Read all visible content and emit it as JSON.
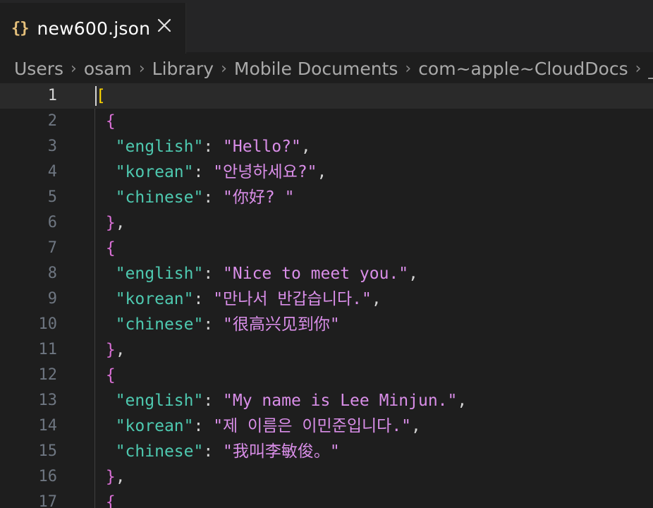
{
  "tab": {
    "icon_glyph": "{}",
    "filename": "new600.json",
    "close_glyph": "×"
  },
  "breadcrumb": [
    "Users",
    "osam",
    "Library",
    "Mobile Documents",
    "com~apple~CloudDocs",
    "_"
  ],
  "colors": {
    "key": "#4ec9b0",
    "string": "#d98ee8",
    "bracket": "#ffd700",
    "brace": "#da70d6",
    "json_icon": "#e5c07b"
  },
  "lines": [
    {
      "n": "1",
      "tokens": [
        {
          "t": "[",
          "c": "bracket"
        }
      ]
    },
    {
      "n": "2",
      "tokens": [
        {
          "t": " {",
          "c": "brace"
        }
      ]
    },
    {
      "n": "3",
      "tokens": [
        {
          "t": "  ",
          "c": "punc"
        },
        {
          "t": "\"english\"",
          "c": "key"
        },
        {
          "t": ": ",
          "c": "punc"
        },
        {
          "t": "\"Hello?\"",
          "c": "str"
        },
        {
          "t": ",",
          "c": "punc"
        }
      ]
    },
    {
      "n": "4",
      "tokens": [
        {
          "t": "  ",
          "c": "punc"
        },
        {
          "t": "\"korean\"",
          "c": "key"
        },
        {
          "t": ": ",
          "c": "punc"
        },
        {
          "t": "\"안녕하세요?\"",
          "c": "str"
        },
        {
          "t": ",",
          "c": "punc"
        }
      ]
    },
    {
      "n": "5",
      "tokens": [
        {
          "t": "  ",
          "c": "punc"
        },
        {
          "t": "\"chinese\"",
          "c": "key"
        },
        {
          "t": ": ",
          "c": "punc"
        },
        {
          "t": "\"你好? \"",
          "c": "str"
        }
      ]
    },
    {
      "n": "6",
      "tokens": [
        {
          "t": " }",
          "c": "brace"
        },
        {
          "t": ",",
          "c": "punc"
        }
      ]
    },
    {
      "n": "7",
      "tokens": [
        {
          "t": " {",
          "c": "brace"
        }
      ]
    },
    {
      "n": "8",
      "tokens": [
        {
          "t": "  ",
          "c": "punc"
        },
        {
          "t": "\"english\"",
          "c": "key"
        },
        {
          "t": ": ",
          "c": "punc"
        },
        {
          "t": "\"Nice to meet you.\"",
          "c": "str"
        },
        {
          "t": ",",
          "c": "punc"
        }
      ]
    },
    {
      "n": "9",
      "tokens": [
        {
          "t": "  ",
          "c": "punc"
        },
        {
          "t": "\"korean\"",
          "c": "key"
        },
        {
          "t": ": ",
          "c": "punc"
        },
        {
          "t": "\"만나서 반갑습니다.\"",
          "c": "str"
        },
        {
          "t": ",",
          "c": "punc"
        }
      ]
    },
    {
      "n": "10",
      "tokens": [
        {
          "t": "  ",
          "c": "punc"
        },
        {
          "t": "\"chinese\"",
          "c": "key"
        },
        {
          "t": ": ",
          "c": "punc"
        },
        {
          "t": "\"很高兴见到你\"",
          "c": "str"
        }
      ]
    },
    {
      "n": "11",
      "tokens": [
        {
          "t": " }",
          "c": "brace"
        },
        {
          "t": ",",
          "c": "punc"
        }
      ]
    },
    {
      "n": "12",
      "tokens": [
        {
          "t": " {",
          "c": "brace"
        }
      ]
    },
    {
      "n": "13",
      "tokens": [
        {
          "t": "  ",
          "c": "punc"
        },
        {
          "t": "\"english\"",
          "c": "key"
        },
        {
          "t": ": ",
          "c": "punc"
        },
        {
          "t": "\"My name is Lee Minjun.\"",
          "c": "str"
        },
        {
          "t": ",",
          "c": "punc"
        }
      ]
    },
    {
      "n": "14",
      "tokens": [
        {
          "t": "  ",
          "c": "punc"
        },
        {
          "t": "\"korean\"",
          "c": "key"
        },
        {
          "t": ": ",
          "c": "punc"
        },
        {
          "t": "\"제 이름은 이민준입니다.\"",
          "c": "str"
        },
        {
          "t": ",",
          "c": "punc"
        }
      ]
    },
    {
      "n": "15",
      "tokens": [
        {
          "t": "  ",
          "c": "punc"
        },
        {
          "t": "\"chinese\"",
          "c": "key"
        },
        {
          "t": ": ",
          "c": "punc"
        },
        {
          "t": "\"我叫李敏俊。\"",
          "c": "str"
        }
      ]
    },
    {
      "n": "16",
      "tokens": [
        {
          "t": " }",
          "c": "brace"
        },
        {
          "t": ",",
          "c": "punc"
        }
      ]
    },
    {
      "n": "17",
      "tokens": [
        {
          "t": " {",
          "c": "brace"
        }
      ]
    }
  ]
}
